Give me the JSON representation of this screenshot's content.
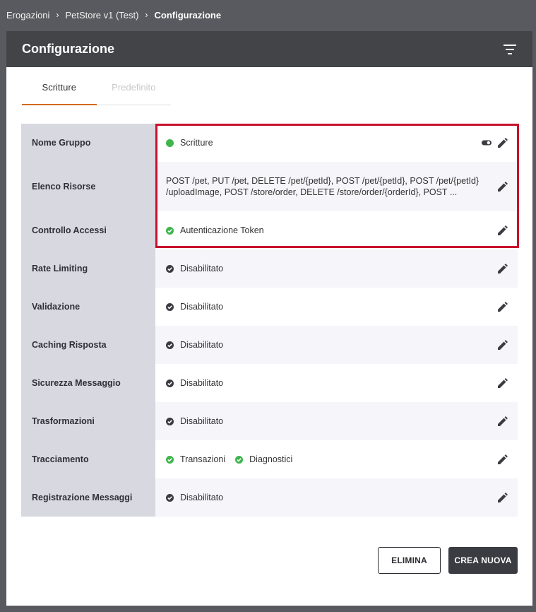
{
  "breadcrumb": {
    "items": [
      "Erogazioni",
      "PetStore v1 (Test)",
      "Configurazione"
    ],
    "separator": "›"
  },
  "panel": {
    "title": "Configurazione",
    "filter_icon": "filter-icon"
  },
  "tabs": [
    {
      "label": "Scritture",
      "active": true
    },
    {
      "label": "Predefinito",
      "active": false
    }
  ],
  "rows": {
    "nome_gruppo": {
      "label": "Nome Gruppo",
      "value": "Scritture",
      "status_color": "#3fb54c"
    },
    "elenco_risorse": {
      "label": "Elenco Risorse",
      "line1": "POST /pet, PUT /pet, DELETE /pet/{petId}, POST /pet/{petId}, POST /pet/{petId}",
      "line2": "/uploadImage, POST /store/order, DELETE /store/order/{orderId}, POST ..."
    },
    "controllo_accessi": {
      "label": "Controllo Accessi",
      "value": "Autenticazione Token"
    },
    "rate_limiting": {
      "label": "Rate Limiting",
      "value": "Disabilitato"
    },
    "validazione": {
      "label": "Validazione",
      "value": "Disabilitato"
    },
    "caching_risposta": {
      "label": "Caching Risposta",
      "value": "Disabilitato"
    },
    "sicurezza_messaggio": {
      "label": "Sicurezza Messaggio",
      "value": "Disabilitato"
    },
    "trasformazioni": {
      "label": "Trasformazioni",
      "value": "Disabilitato"
    },
    "tracciamento": {
      "label": "Tracciamento",
      "value1": "Transazioni",
      "value2": "Diagnostici"
    },
    "registrazione_messaggi": {
      "label": "Registrazione Messaggi",
      "value": "Disabilitato"
    }
  },
  "buttons": {
    "delete_label": "ELIMINA",
    "new_label": "CREA NUOVA"
  },
  "colors": {
    "highlight": "#c8102e",
    "enabled": "#3fb54c",
    "disabled": "#3b3c42",
    "tab_accent": "#d2691e"
  }
}
